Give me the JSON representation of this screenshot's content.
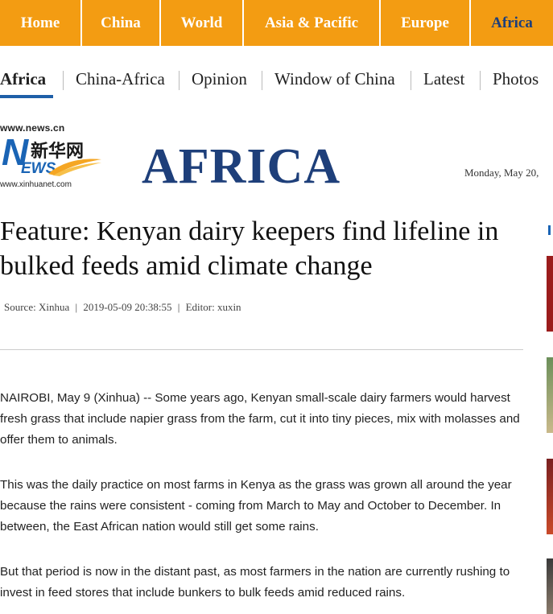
{
  "top_nav": {
    "items": [
      {
        "label": "Home"
      },
      {
        "label": "China"
      },
      {
        "label": "World"
      },
      {
        "label": "Asia & Pacific"
      },
      {
        "label": "Europe"
      },
      {
        "label": "Africa"
      }
    ],
    "active": "Africa",
    "bg_color": "#f39c12",
    "active_text_color": "#1e3f7a"
  },
  "sub_nav": {
    "items": [
      {
        "label": "Africa"
      },
      {
        "label": "China-Africa"
      },
      {
        "label": "Opinion"
      },
      {
        "label": "Window of China"
      },
      {
        "label": "Latest"
      },
      {
        "label": "Photos"
      }
    ],
    "active": "Africa",
    "underline_color": "#1e5fa8"
  },
  "logo": {
    "url_top": "www.news.cn",
    "letter_n": "N",
    "chinese": "新华网",
    "letters_ews": "EWS",
    "url_bottom": "www.xinhuanet.com"
  },
  "section_title": "AFRICA",
  "date": "Monday, May  20,",
  "article": {
    "headline": "Feature: Kenyan dairy keepers find lifeline in bulked feeds amid climate change",
    "source": "Source: Xinhua",
    "timestamp": "2019-05-09 20:38:55",
    "editor": "Editor: xuxin",
    "paragraphs": [
      "NAIROBI, May 9 (Xinhua) -- Some years ago, Kenyan small-scale dairy farmers would harvest fresh grass that include napier grass from the farm, cut it into tiny pieces, mix with molasses and offer them to animals.",
      "This was the daily practice on most farms in Kenya as the grass was grown all around the year because the rains were consistent - coming from March to May and October to December. In between, the East African nation would still get some rains.",
      "But that period is now in the distant past, as most farmers in the nation are currently rushing to invest in feed stores that include bunkers to bulk feeds amid reduced rains."
    ]
  },
  "meta_separator": "|",
  "colors": {
    "brand_blue": "#1e3f7a",
    "logo_blue": "#1a64b5",
    "accent_orange": "#f39c12"
  }
}
